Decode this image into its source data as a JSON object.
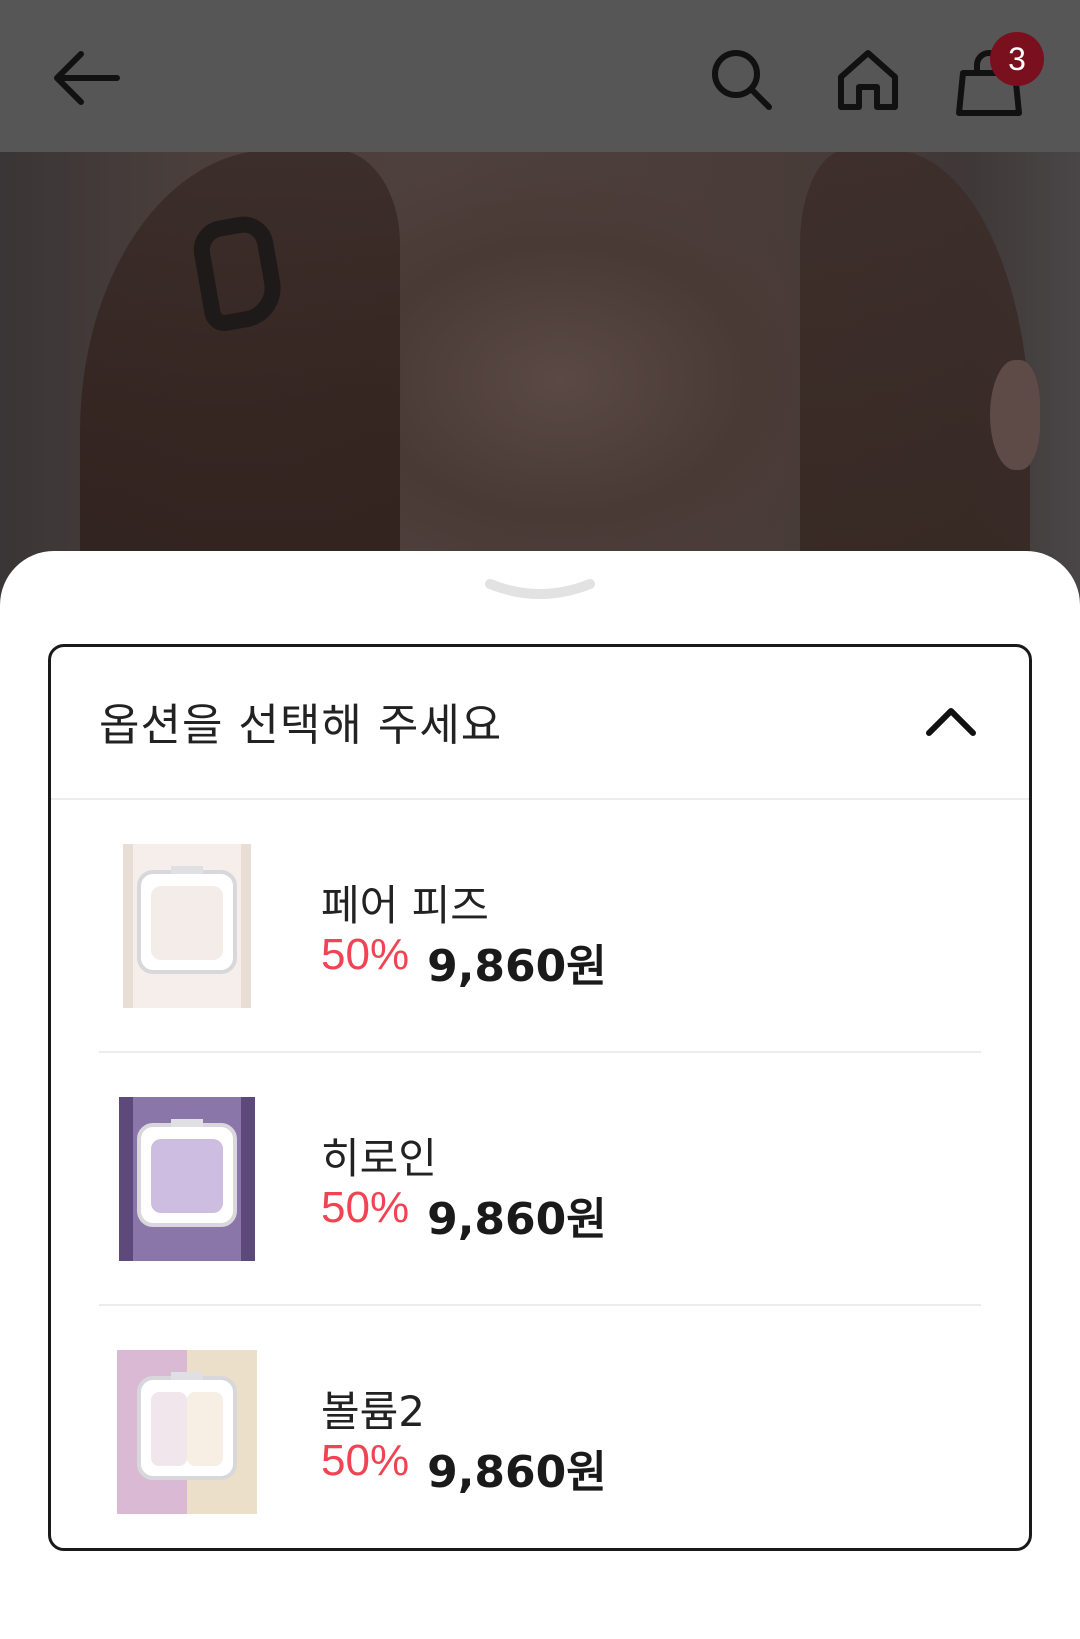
{
  "header": {
    "cart_count": "3"
  },
  "icons": {
    "back": "back-arrow-icon",
    "search": "search-icon",
    "home": "home-icon",
    "cart": "shopping-bag-icon",
    "collapse": "chevron-up-icon",
    "handle": "chevron-down-handle-icon"
  },
  "option_select": {
    "title": "옵션을 선택해 주세요",
    "items": [
      {
        "name": "페어 피즈",
        "discount": "50%",
        "price": "9,860원",
        "swatch": "#f3ece8"
      },
      {
        "name": "히로인",
        "discount": "50%",
        "price": "9,860원",
        "swatch": "#cdbde0"
      },
      {
        "name": "볼륨2",
        "discount": "50%",
        "price": "9,860원",
        "swatch": "#f0e6ec"
      }
    ]
  },
  "colors": {
    "discount": "#f04452",
    "badge": "#7a0f1e",
    "appbar": "#565656"
  }
}
